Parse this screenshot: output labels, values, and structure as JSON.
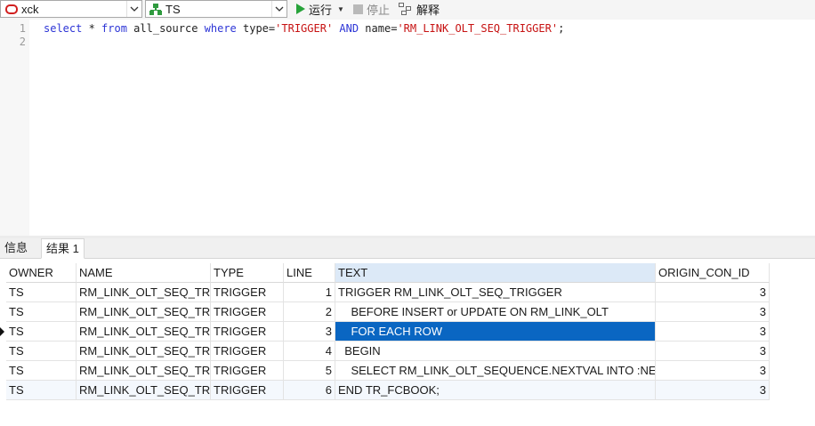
{
  "toolbar": {
    "connection": "xck",
    "schema": "TS",
    "run_label": "运行",
    "stop_label": "停止",
    "explain_label": "解释"
  },
  "editor": {
    "line_numbers": [
      "1",
      "2"
    ],
    "query": {
      "select": "select",
      "star": " * ",
      "from": "from",
      "table": " all_source ",
      "where": "where",
      "col1": " type=",
      "val1": "'TRIGGER'",
      "and": " AND",
      "col2": " name=",
      "val2": "'RM_LINK_OLT_SEQ_TRIGGER'",
      "end": ";"
    }
  },
  "tabs": {
    "info": "信息",
    "result": "结果 1"
  },
  "grid": {
    "columns": [
      "OWNER",
      "NAME",
      "TYPE",
      "LINE",
      "TEXT",
      "ORIGIN_CON_ID"
    ],
    "selected_row": 2,
    "rows": [
      [
        "TS",
        "RM_LINK_OLT_SEQ_TRIGGER",
        "TRIGGER",
        "1",
        "TRIGGER RM_LINK_OLT_SEQ_TRIGGER",
        "3"
      ],
      [
        "TS",
        "RM_LINK_OLT_SEQ_TRIGGER",
        "TRIGGER",
        "2",
        "    BEFORE INSERT or UPDATE ON RM_LINK_OLT",
        "3"
      ],
      [
        "TS",
        "RM_LINK_OLT_SEQ_TRIGGER",
        "TRIGGER",
        "3",
        "    FOR EACH ROW",
        "3"
      ],
      [
        "TS",
        "RM_LINK_OLT_SEQ_TRIGGER",
        "TRIGGER",
        "4",
        "  BEGIN",
        "3"
      ],
      [
        "TS",
        "RM_LINK_OLT_SEQ_TRIGGER",
        "TRIGGER",
        "5",
        "    SELECT RM_LINK_OLT_SEQUENCE.NEXTVAL INTO :NEW.ID",
        "3"
      ],
      [
        "TS",
        "RM_LINK_OLT_SEQ_TRIGGER",
        "TRIGGER",
        "6",
        "END TR_FCBOOK;",
        "3"
      ]
    ]
  },
  "colors": {
    "selection": "#0a66c2",
    "keyword": "#2d35d6",
    "string": "#c71313",
    "run_icon": "#27a33a"
  },
  "icons": {
    "connection": "oracle-connection-icon",
    "schema": "schema-tree-icon",
    "run": "play-icon",
    "stop": "stop-icon",
    "explain": "explain-plan-icon",
    "dropdown": "chevron-down-icon",
    "row_marker": "current-row-marker-icon"
  }
}
